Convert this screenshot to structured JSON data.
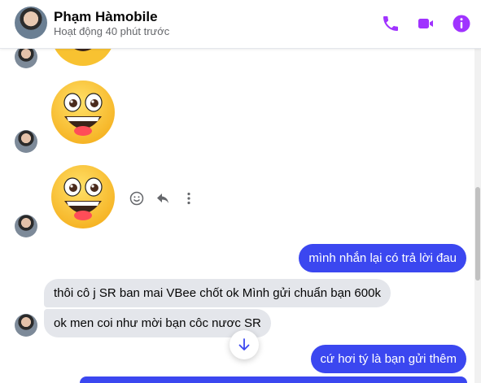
{
  "header": {
    "name": "Phạm Hàmobile",
    "status": "Hoạt động 40 phút trước",
    "accent_color": "#a033ff",
    "icons": [
      "phone-icon",
      "video-camera-icon",
      "info-icon"
    ]
  },
  "messages": [
    {
      "type": "emoji",
      "from": "them",
      "emoji": "grinning-face-with-big-eyes"
    },
    {
      "type": "emoji",
      "from": "them",
      "emoji": "grinning-face-with-big-eyes"
    },
    {
      "type": "emoji",
      "from": "them",
      "emoji": "grinning-face-with-big-eyes"
    },
    {
      "type": "text",
      "from": "me",
      "text": "mình nhắn lại có trả lời đau"
    },
    {
      "type": "text",
      "from": "them",
      "text": "thôi cô j SR ban mai VBee chốt ok Mình gửi chuẩn bạn 600k"
    },
    {
      "type": "text",
      "from": "them",
      "text": "ok men coi như mời bạn côc nươc SR"
    },
    {
      "type": "text",
      "from": "me",
      "text": "cứ hơi tý là bạn gửi thêm"
    }
  ],
  "message_actions": [
    "smile-icon",
    "reply-icon",
    "more-vertical-icon"
  ],
  "colors": {
    "outgoing_bubble": "#3b47f0",
    "incoming_bubble": "#e4e6eb",
    "emoji_face": "#f8c231"
  }
}
